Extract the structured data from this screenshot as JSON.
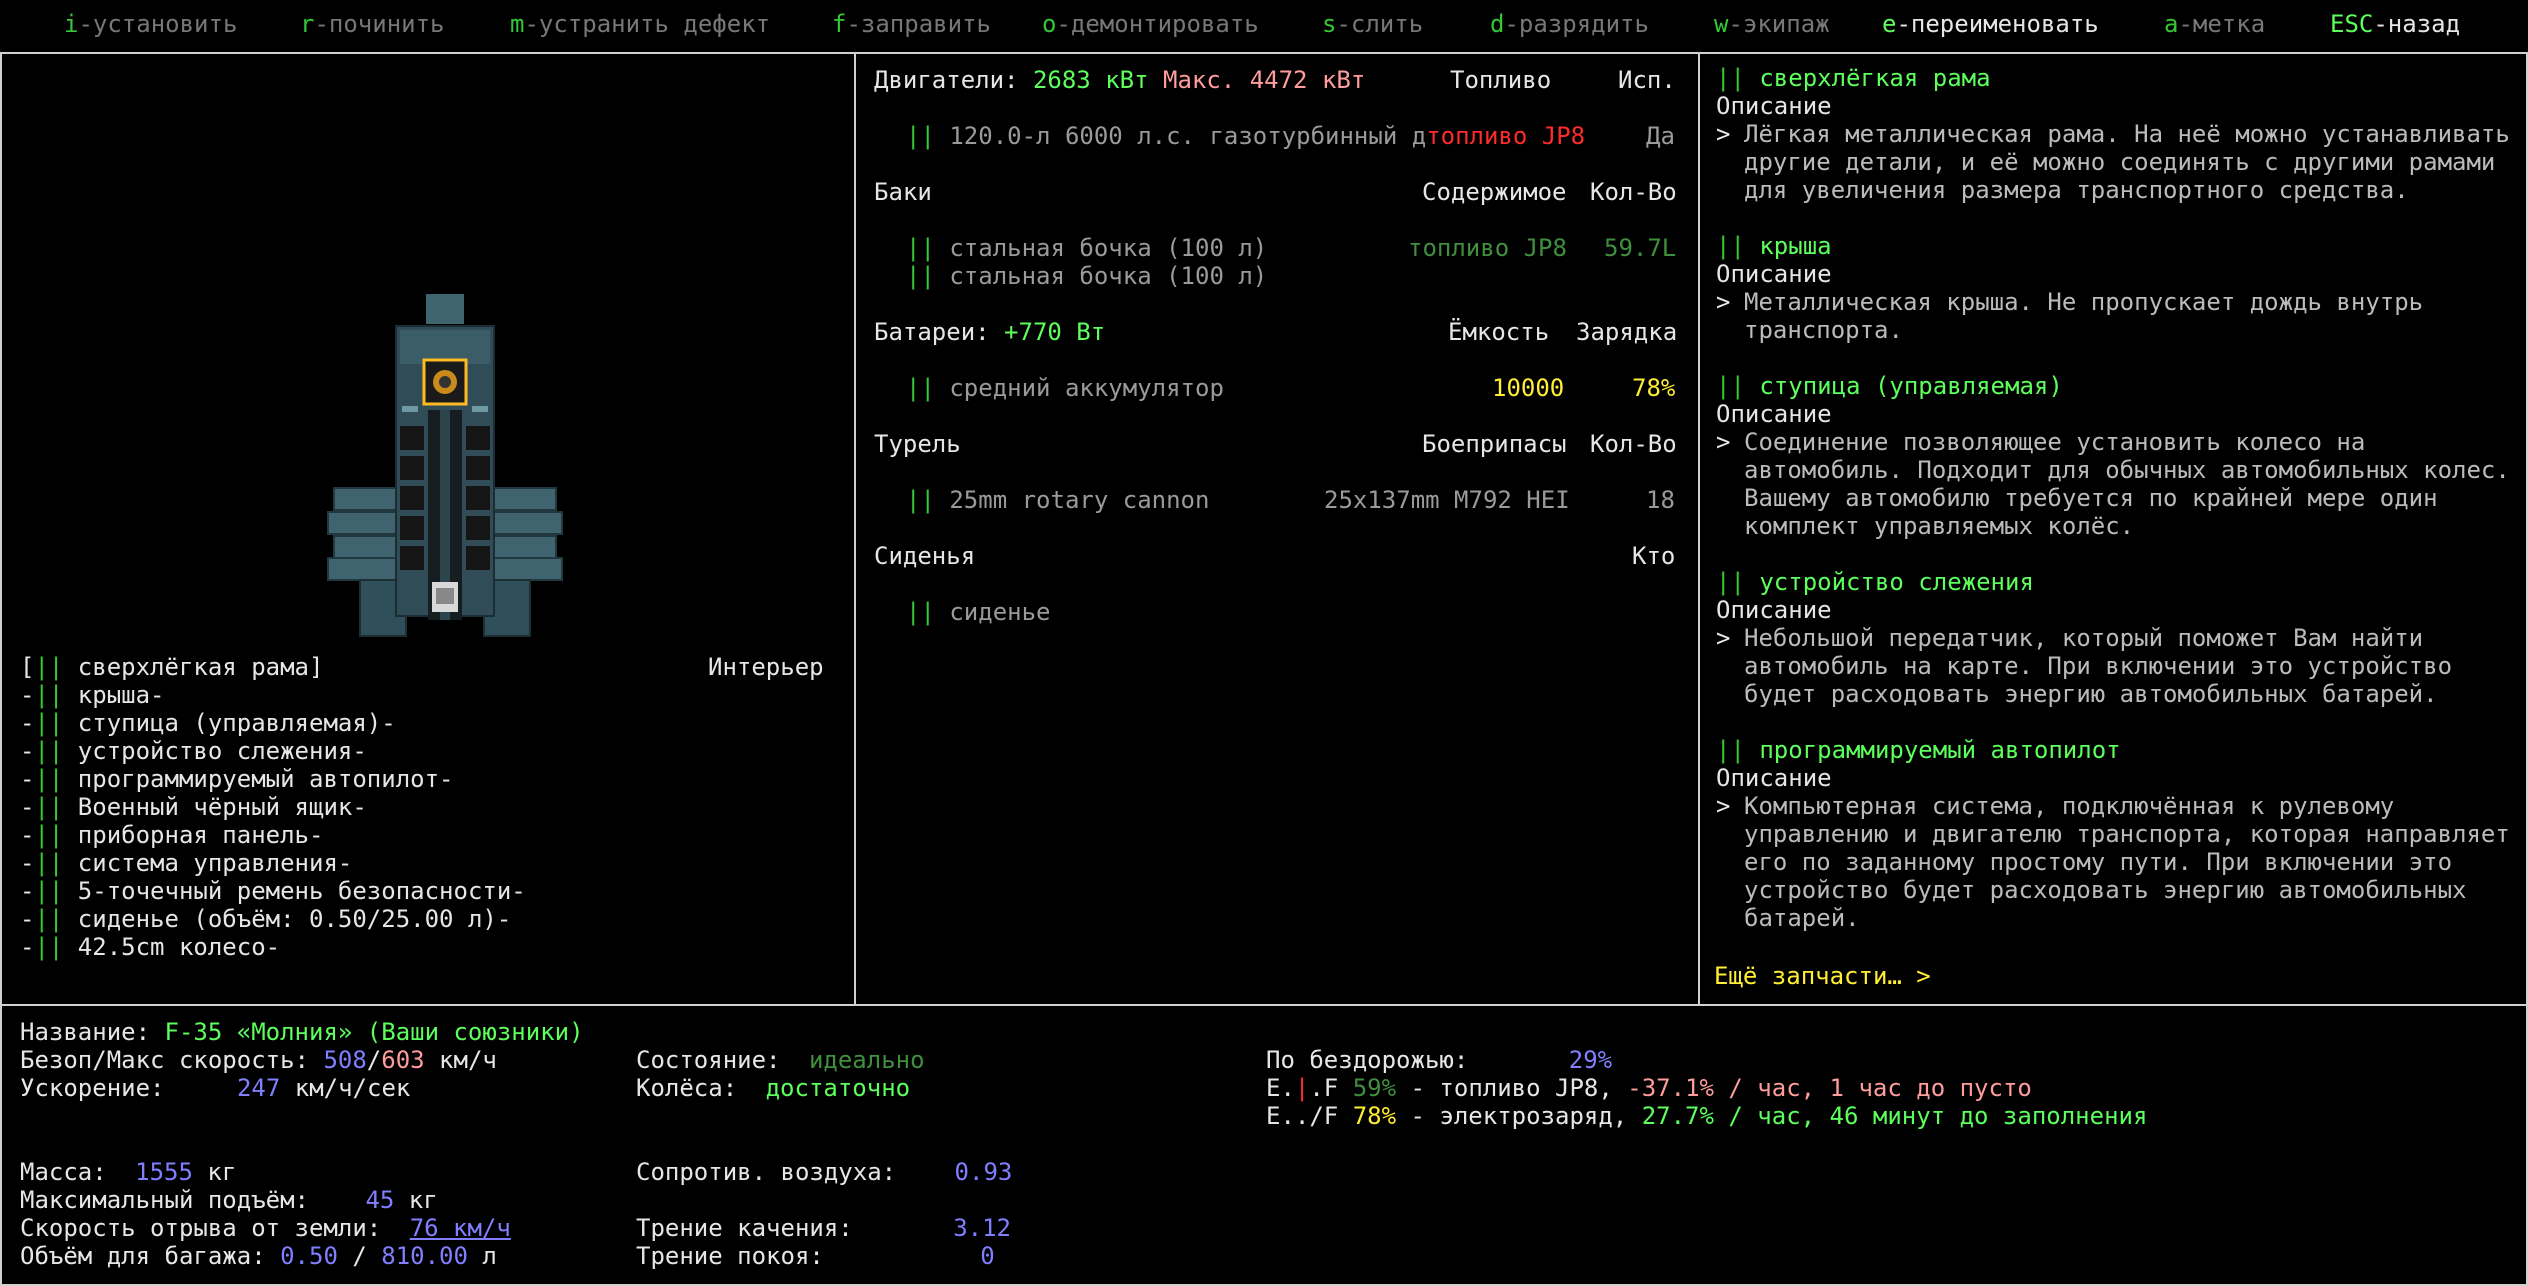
{
  "hotkeys": [
    {
      "key": "i",
      "label": "-установить",
      "key_color": "#34c834",
      "label_color": "#7a7a7a"
    },
    {
      "key": "r",
      "label": "-починить",
      "key_color": "#34c834",
      "label_color": "#7a7a7a"
    },
    {
      "key": "m",
      "label": "-устранить дефект",
      "key_color": "#34c834",
      "label_color": "#7a7a7a"
    },
    {
      "key": "f",
      "label": "-заправить",
      "key_color": "#34c834",
      "label_color": "#7a7a7a"
    },
    {
      "key": "o",
      "label": "-демонтировать",
      "key_color": "#34c834",
      "label_color": "#7a7a7a"
    },
    {
      "key": "s",
      "label": "-слить",
      "key_color": "#34c834",
      "label_color": "#7a7a7a"
    },
    {
      "key": "d",
      "label": "-разрядить",
      "key_color": "#34c834",
      "label_color": "#7a7a7a"
    },
    {
      "key": "w",
      "label": "-экипаж",
      "key_color": "#34c834",
      "label_color": "#7a7a7a"
    },
    {
      "key": "e",
      "label": "-переименовать",
      "key_color": "#5cff5c",
      "label_color": "#e6e6e6"
    },
    {
      "key": "a",
      "label": "-метка",
      "key_color": "#34c834",
      "label_color": "#7a7a7a"
    },
    {
      "key": "ESC",
      "label": "-назад",
      "key_color": "#5cff5c",
      "label_color": "#e6e6e6"
    }
  ],
  "parts_list": {
    "interior_label": "Интерьер",
    "selected": {
      "open": "[",
      "sym": "||",
      "name": " сверхлёгкая рама",
      "close": "]"
    },
    "items": [
      {
        "sym": "||",
        "name": " крыша-"
      },
      {
        "sym": "||",
        "name": " ступица (управляемая)-"
      },
      {
        "sym": "||",
        "name": " устройство слежения-"
      },
      {
        "sym": "||",
        "name": " программируемый автопилот-"
      },
      {
        "sym": "||",
        "name": " Военный чёрный ящик-"
      },
      {
        "sym": "||",
        "name": " приборная панель-"
      },
      {
        "sym": "||",
        "name": " система управления-"
      },
      {
        "sym": "||",
        "name": " 5-точечный ремень безопасности-"
      },
      {
        "sym": "||",
        "name": " сиденье (объём: 0.50/25.00 л)-"
      },
      {
        "sym": "||",
        "name": " 42.5cm колесо-"
      }
    ]
  },
  "middle": {
    "engines": {
      "label": "Двигатели: ",
      "power": "2683 кВт",
      "max_label": " Макс. ",
      "max_power": "4472 кВт",
      "col_fuel": "Топливо",
      "col_use": "Исп."
    },
    "engine_items": [
      {
        "sym": "||",
        "name": " 120.0-л 6000 л.с. газотурбинный д",
        "fuel": "топливо JP8",
        "use": "Да"
      }
    ],
    "tanks": {
      "label": "Баки",
      "col_contents": "Содержимое",
      "col_qty": "Кол-Во"
    },
    "tank_items": [
      {
        "sym": "||",
        "name": " стальная бочка (100 л)",
        "contents": "топливо JP8",
        "qty": "59.7L"
      },
      {
        "sym": "||",
        "name": " стальная бочка (100 л)",
        "contents": "",
        "qty": ""
      }
    ],
    "batteries": {
      "label": "Батареи: ",
      "value": "+770 Вт",
      "col_capacity": "Ёмкость",
      "col_charge": "Зарядка"
    },
    "battery_items": [
      {
        "sym": "||",
        "name": " средний аккумулятор",
        "capacity": "10000",
        "charge": "78%"
      }
    ],
    "turret": {
      "label": "Турель",
      "col_ammo": "Боеприпасы",
      "col_qty": "Кол-Во"
    },
    "turret_items": [
      {
        "sym": "||",
        "name": " 25mm rotary cannon",
        "ammo": "25x137mm M792 HEI",
        "qty": "18"
      }
    ],
    "seats": {
      "label": "Сиденья",
      "col_who": "Кто"
    },
    "seat_items": [
      {
        "sym": "||",
        "name": " сиденье"
      }
    ]
  },
  "descriptions": {
    "heading": "Описание",
    "entries": [
      {
        "sym": "||",
        "title": " сверхлёгкая рама",
        "text": "Лёгкая металлическая рама. На неё можно устанавливать другие детали, и её можно соединять с другими рамами для увеличения размера транспортного средства."
      },
      {
        "sym": "||",
        "title": " крыша",
        "text": "Металлическая крыша.  Не пропускает дождь внутрь транспорта."
      },
      {
        "sym": "||",
        "title": " ступица (управляемая)",
        "text": "Соединение позволяющее установить колесо на автомобиль. Подходит для обычных автомобильных колес.  Вашему автомобилю требуется по крайней мере один комплект управляемых колёс."
      },
      {
        "sym": "||",
        "title": " устройство слежения",
        "text": "Небольшой передатчик, который поможет Вам найти автомобиль на карте.  При включении это устройство будет расходовать энергию автомобильных батарей."
      },
      {
        "sym": "||",
        "title": " программируемый автопилот",
        "text": "Компьютерная система, подключённая к рулевому управлению и двигателю транспорта, которая направляет его по заданному простому пути.  При включении это устройство будет расходовать энергию автомобильных батарей."
      }
    ],
    "more_label": "Ещё запчасти… >"
  },
  "stats": {
    "name_label": "Название: ",
    "name_value": "F-35 «Молния» (Ваши союзники)",
    "safe_speed_label": "Безоп/Макс скорость: ",
    "safe_speed": "508",
    "speed_sep": "/",
    "max_speed": "603",
    "speed_unit": " км/ч",
    "accel_label": "Ускорение: ",
    "accel_value": "247",
    "accel_unit": " км/ч/сек",
    "condition_label": "Состояние: ",
    "condition_value": "идеально",
    "wheels_label": "Колёса: ",
    "wheels_value": "достаточно",
    "offroad_label": "По бездорожью: ",
    "offroad_value": "29%",
    "fuel_gauge": {
      "e": "E.",
      "mark": "|",
      "f": ".F ",
      "pct": "59%",
      "desc": " - топливо JP8, ",
      "rate": "-37.1% / час, 1 час до пусто"
    },
    "charge_gauge": {
      "e": "E../F ",
      "pct": "78%",
      "desc": " - электрозаряд, ",
      "rate": "27.7% / час, 46 минут до заполнения"
    },
    "mass_label": "Масса: ",
    "mass_value": "1555",
    "mass_unit": " кг",
    "lift_label": "Максимальный подъём: ",
    "lift_value": "45",
    "lift_unit": " кг",
    "takeoff_label": "Скорость отрыва от земли: ",
    "takeoff_value": "76 км/ч",
    "cargo_label": "Объём для багажа: ",
    "cargo_value": "0.50",
    "cargo_sep": " / ",
    "cargo_max": "810.00",
    "cargo_unit": " л",
    "drag_label": "Сопротив. воздуха: ",
    "drag_value": "0.93",
    "rolling_label": "Трение качения: ",
    "rolling_value": "3.12",
    "static_label": "Трение покоя: ",
    "static_value": "0"
  }
}
